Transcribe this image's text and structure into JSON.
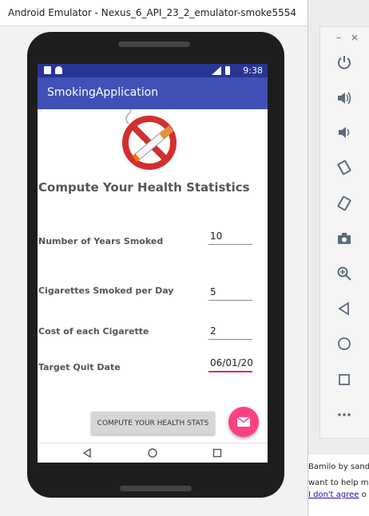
{
  "window": {
    "title": "Android Emulator - Nexus_6_API_23_2_emulator-smoke5554"
  },
  "status_bar": {
    "time": "9:38"
  },
  "app": {
    "title": "SmokingApplication",
    "heading": "Compute Your Health Statistics",
    "fields": [
      {
        "label": "Number of Years Smoked",
        "value": "10"
      },
      {
        "label": "Cigarettes Smoked per Day",
        "value": "5"
      },
      {
        "label": "Cost of each Cigarette",
        "value": "2"
      },
      {
        "label": "Target Quit Date",
        "value": "06/01/20"
      }
    ],
    "compute_button": "COMPUTE YOUR HEALTH STATS",
    "fab_icon": "email-icon",
    "accent": "#ff4081",
    "primary": "#3f51b5",
    "primary_dark": "#283593"
  },
  "toolbar": {
    "minimize": "–",
    "close": "×",
    "buttons": [
      "power-icon",
      "volume-up-icon",
      "volume-down-icon",
      "rotate-left-icon",
      "rotate-right-icon",
      "camera-icon",
      "zoom-icon",
      "back-icon",
      "home-icon",
      "overview-icon",
      "more-icon"
    ]
  },
  "background_page": {
    "line1": "Bamilo by sandi",
    "line2": "want to help m",
    "link": "I don't agree",
    "line3_suffix": " o"
  }
}
